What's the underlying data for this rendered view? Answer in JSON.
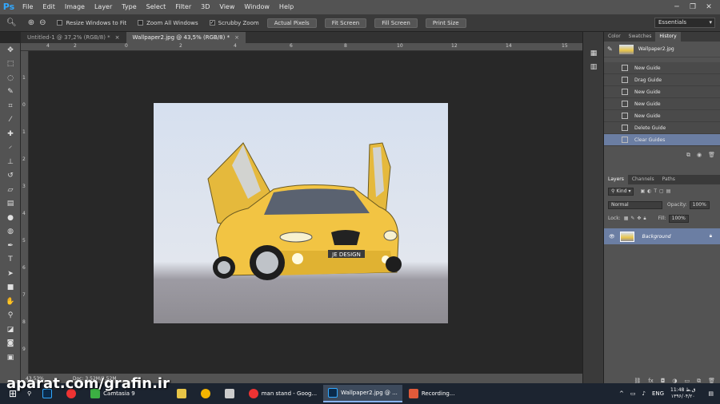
{
  "app": {
    "logo": "Ps"
  },
  "menu": [
    "File",
    "Edit",
    "Image",
    "Layer",
    "Type",
    "Select",
    "Filter",
    "3D",
    "View",
    "Window",
    "Help"
  ],
  "window_controls": [
    "─",
    "❐",
    "✕"
  ],
  "options": {
    "checks": [
      {
        "label": "Resize Windows to Fit",
        "checked": false
      },
      {
        "label": "Zoom All Windows",
        "checked": false
      },
      {
        "label": "Scrubby Zoom",
        "checked": true
      }
    ],
    "buttons": [
      "Actual Pixels",
      "Fit Screen",
      "Fill Screen",
      "Print Size"
    ],
    "workspace": "Essentials"
  },
  "tabs": [
    {
      "label": "Untitled-1 @ 37,2% (RGB/8) *",
      "active": false
    },
    {
      "label": "Wallpaper2.jpg @ 43,5% (RGB/8) *",
      "active": true
    }
  ],
  "ruler_top": [
    "4",
    "2",
    "0",
    "2",
    "4",
    "6",
    "8",
    "10",
    "12",
    "14",
    "15"
  ],
  "ruler_left": [
    "1",
    "0",
    "1",
    "2",
    "3",
    "4",
    "5",
    "6",
    "7",
    "8",
    "9"
  ],
  "status": {
    "zoom": "43,53%",
    "doc": "Doc: 3,52M/3,52M"
  },
  "history_panel": {
    "tabs": [
      "Color",
      "Swatches",
      "History"
    ],
    "snapshot": "Wallpaper2.jpg",
    "items": [
      {
        "label": "New Guide",
        "selected": false
      },
      {
        "label": "Drag Guide",
        "selected": false
      },
      {
        "label": "New Guide",
        "selected": false
      },
      {
        "label": "New Guide",
        "selected": false
      },
      {
        "label": "New Guide",
        "selected": false
      },
      {
        "label": "Delete Guide",
        "selected": false
      },
      {
        "label": "Clear Guides",
        "selected": true
      }
    ]
  },
  "layers_panel": {
    "tabs": [
      "Layers",
      "Channels",
      "Paths"
    ],
    "kind": "Kind",
    "blend": "Normal",
    "opacity_label": "Opacity:",
    "opacity": "100%",
    "lock_label": "Lock:",
    "fill_label": "Fill:",
    "fill": "100%",
    "layers": [
      {
        "name": "Background"
      }
    ]
  },
  "canvas": {
    "plate": "JE DESIGN"
  },
  "taskbar": {
    "items": [
      {
        "label": "Camtasia 9",
        "active": false
      },
      {
        "label": "man stand - Goog...",
        "active": false
      },
      {
        "label": "Wallpaper2.jpg @ ...",
        "active": true
      },
      {
        "label": "Recording...",
        "active": false
      }
    ],
    "lang": "ENG",
    "time": "11:48 ق.ظ",
    "date": "۱۳۹۶/۰۴/۲۰"
  },
  "watermark": "aparat.com/grafin.ir"
}
